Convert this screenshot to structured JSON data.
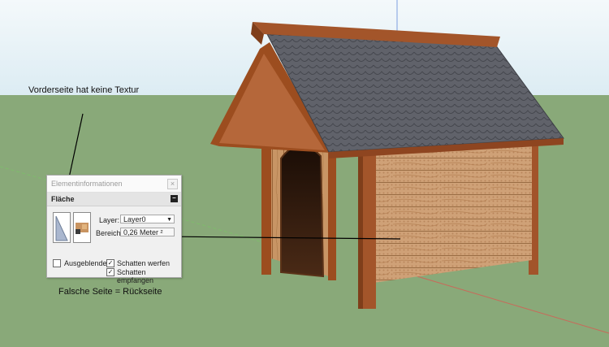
{
  "annotations": {
    "front_note": "Vorderseite hat keine Textur",
    "back_note": "Falsche Seite = Rückseite"
  },
  "panel": {
    "title": "Elementinformationen",
    "section": "Fläche",
    "layer_label": "Layer:",
    "layer_value": "Layer0",
    "area_label": "Bereich:",
    "area_value": "0,26 Meter ²",
    "hidden_label": "Ausgeblendet",
    "cast_shadows_label": "Schatten werfen",
    "receive_shadows_label": "Schatten empfangen",
    "hidden_checked": false,
    "cast_shadows_checked": true,
    "receive_shadows_checked": true
  },
  "colors": {
    "sky": "#e6f1f6",
    "ground": "#89a979",
    "roof": "#5d5f66",
    "wood": "#c89a6c",
    "trim": "#9c4d1f"
  }
}
